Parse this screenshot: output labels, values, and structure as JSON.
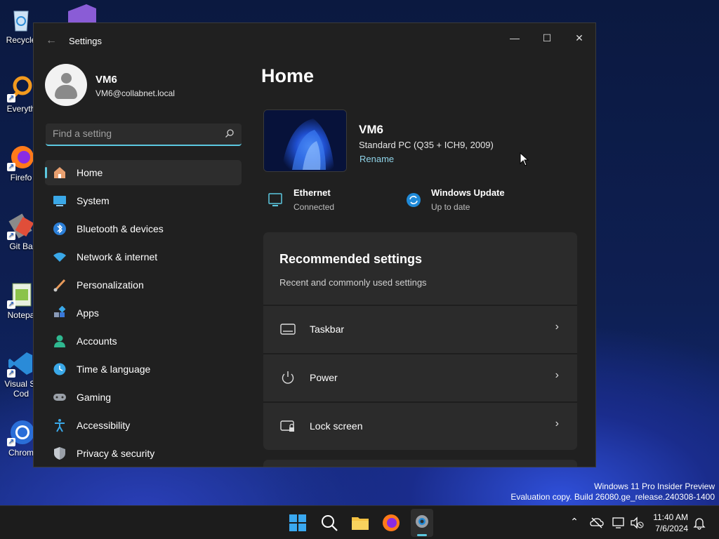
{
  "desktop": {
    "icons": [
      {
        "label": "Recycle"
      },
      {
        "label": "Everyth"
      },
      {
        "label": "Firefo"
      },
      {
        "label": "Git Ba"
      },
      {
        "label": "Notepa"
      },
      {
        "label": "Visual St",
        "label2": "Cod"
      },
      {
        "label": "Chrom"
      }
    ],
    "watermark": {
      "line1": "Windows 11 Pro Insider Preview",
      "line2": "Evaluation copy. Build 26080.ge_release.240308-1400"
    }
  },
  "window": {
    "title": "Settings",
    "controls": {
      "minimize": "—",
      "maximize": "☐",
      "close": "✕"
    }
  },
  "profile": {
    "name": "VM6",
    "email": "VM6@collabnet.local"
  },
  "search": {
    "placeholder": "Find a setting"
  },
  "nav": {
    "items": [
      {
        "label": "Home",
        "icon": "home-icon",
        "active": true
      },
      {
        "label": "System",
        "icon": "system-icon"
      },
      {
        "label": "Bluetooth & devices",
        "icon": "bluetooth-icon"
      },
      {
        "label": "Network & internet",
        "icon": "network-icon"
      },
      {
        "label": "Personalization",
        "icon": "brush-icon"
      },
      {
        "label": "Apps",
        "icon": "apps-icon"
      },
      {
        "label": "Accounts",
        "icon": "accounts-icon"
      },
      {
        "label": "Time & language",
        "icon": "time-language-icon"
      },
      {
        "label": "Gaming",
        "icon": "gaming-icon"
      },
      {
        "label": "Accessibility",
        "icon": "accessibility-icon"
      },
      {
        "label": "Privacy & security",
        "icon": "shield-icon"
      }
    ]
  },
  "main": {
    "title": "Home",
    "device": {
      "name": "VM6",
      "model": "Standard PC (Q35 + ICH9, 2009)",
      "rename": "Rename"
    },
    "status": [
      {
        "title": "Ethernet",
        "sub": "Connected",
        "icon": "ethernet-icon"
      },
      {
        "title": "Windows Update",
        "sub": "Up to date",
        "icon": "windows-update-icon"
      }
    ],
    "recommended": {
      "title": "Recommended settings",
      "subtitle": "Recent and commonly used settings",
      "rows": [
        {
          "label": "Taskbar",
          "icon": "taskbar-icon"
        },
        {
          "label": "Power",
          "icon": "power-icon"
        },
        {
          "label": "Lock screen",
          "icon": "lock-screen-icon"
        }
      ]
    }
  },
  "taskbar": {
    "clock_time": "11:40 AM",
    "clock_date": "7/6/2024"
  },
  "colors": {
    "accent": "#5cc8e0",
    "window_bg": "#202020",
    "card_bg": "#2b2b2b"
  }
}
